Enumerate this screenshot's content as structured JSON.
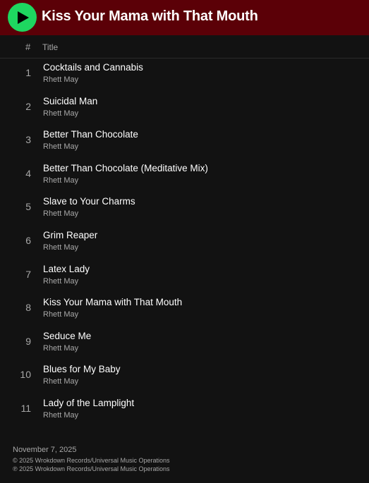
{
  "header": {
    "title": "Kiss Your Mama with That Mouth",
    "play_icon": "play-icon",
    "accent_color": "#1ed760",
    "background_color": "#5b0007"
  },
  "table": {
    "column_number": "#",
    "column_title": "Title"
  },
  "tracks": [
    {
      "number": "1",
      "title": "Cocktails and Cannabis",
      "artist": "Rhett May"
    },
    {
      "number": "2",
      "title": "Suicidal Man",
      "artist": "Rhett May"
    },
    {
      "number": "3",
      "title": "Better Than Chocolate",
      "artist": "Rhett May"
    },
    {
      "number": "4",
      "title": "Better Than Chocolate (Meditative Mix)",
      "artist": "Rhett May"
    },
    {
      "number": "5",
      "title": "Slave to Your Charms",
      "artist": "Rhett May"
    },
    {
      "number": "6",
      "title": "Grim Reaper",
      "artist": "Rhett May"
    },
    {
      "number": "7",
      "title": "Latex Lady",
      "artist": "Rhett May"
    },
    {
      "number": "8",
      "title": "Kiss Your Mama with That Mouth",
      "artist": "Rhett May"
    },
    {
      "number": "9",
      "title": "Seduce Me",
      "artist": "Rhett May"
    },
    {
      "number": "10",
      "title": "Blues for My Baby",
      "artist": "Rhett May"
    },
    {
      "number": "11",
      "title": "Lady of the Lamplight",
      "artist": "Rhett May"
    }
  ],
  "footer": {
    "release_date": "November 7, 2025",
    "copyright": "© 2025 Wrokdown Records/Universal Music Operations",
    "phonographic": "℗ 2025 Wrokdown Records/Universal Music Operations"
  }
}
